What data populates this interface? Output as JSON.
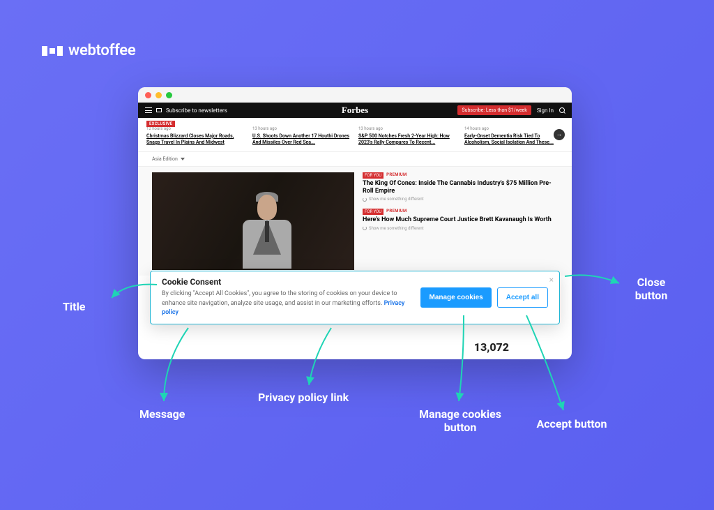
{
  "logo_text": "webtoffee",
  "browser": {
    "topnav": {
      "subscribe_newsletters": "Subscribe to newsletters",
      "site_logo": "Forbes",
      "subscribe_cta": "Subscribe: Less than $1/week",
      "signin": "Sign In"
    },
    "exclusive_badge": "EXCLUSIVE",
    "news": [
      {
        "time": "12 hours ago",
        "headline": "Christmas Blizzard Closes Major Roads, Snags Travel In Plains And Midwest"
      },
      {
        "time": "13 hours ago",
        "headline": "U.S. Shoots Down Another 17 Houthi Drones And Missiles Over Red Sea..."
      },
      {
        "time": "13 hours ago",
        "headline": "S&P 500 Notches Fresh 2-Year High: How 2023's Rally Compares To Recent..."
      },
      {
        "time": "14 hours ago",
        "headline": "Early-Onset Dementia Risk Tied To Alcoholism, Social Isolation And These..."
      }
    ],
    "edition_label": "Asia Edition",
    "side_articles": [
      {
        "tag": "FOR YOU",
        "tag2": "PREMIUM",
        "title": "The King Of Cones: Inside The Cannabis Industry's $75 Million Pre-Roll Empire",
        "sub": "Show me something different"
      },
      {
        "tag": "FOR YOU",
        "tag2": "PREMIUM",
        "title": "Here's How Much Supreme Court Justice Brett Kavanaugh Is Worth",
        "sub": "Show me something different"
      }
    ],
    "big_number": "13,072"
  },
  "cookie_banner": {
    "title": "Cookie Consent",
    "message": "By clicking \"Accept All Cookies\", you agree to the storing of cookies on your device to enhance site navigation, analyze site usage, and assist in our marketing efforts.",
    "privacy_link": "Privacy policy",
    "manage_label": "Manage cookies",
    "accept_label": "Accept all",
    "close_symbol": "×"
  },
  "annotations": {
    "title": "Title",
    "message": "Message",
    "privacy": "Privacy policy link",
    "manage": "Manage cookies button",
    "accept": "Accept button",
    "close": "Close button"
  },
  "colors": {
    "teal": "#1fd4b5"
  }
}
